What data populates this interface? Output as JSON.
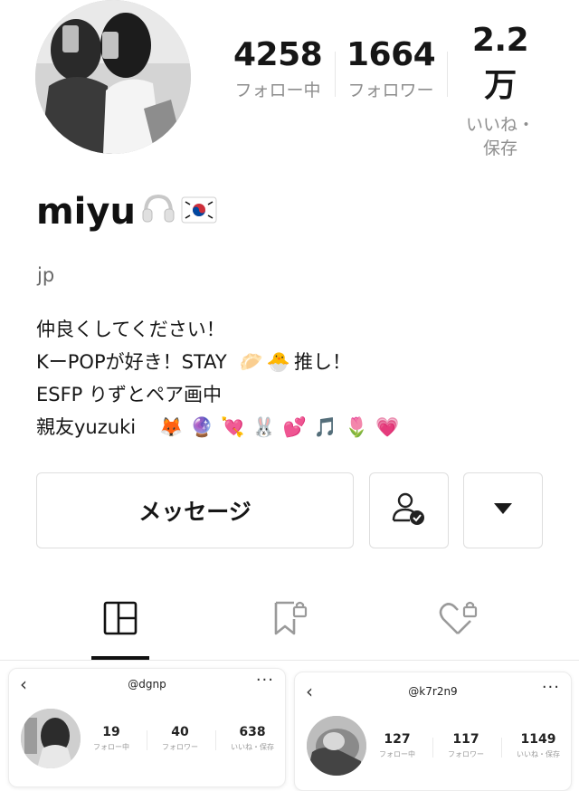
{
  "profile": {
    "username": "miyu",
    "subname": "jp",
    "stats": [
      {
        "value": "4258",
        "label": "フォロー中"
      },
      {
        "value": "1664",
        "label": "フォロワー"
      },
      {
        "value": "2.2万",
        "label": "いいね・保存"
      }
    ],
    "name_emojis": [
      "headphones-icon",
      "korea-flag-icon"
    ],
    "bio": [
      {
        "text": "仲良くしてください！"
      },
      {
        "text": "KーPOPが好き！STAY",
        "after": "🥟🐣",
        "tail": "推し！"
      },
      {
        "text": "ESFP りずとペア画中"
      },
      {
        "text": "親友yuzuki",
        "after": "🦊🔮💘🐰💕🎵🌷💗"
      }
    ]
  },
  "actions": {
    "message_label": "メッセージ",
    "follow_icon": "user-check-icon",
    "more_icon": "dropdown-triangle-icon"
  },
  "tabs": [
    {
      "icon": "grid-icon",
      "active": true
    },
    {
      "icon": "bookmark-lock-icon",
      "active": false
    },
    {
      "icon": "heart-lock-icon",
      "active": false
    }
  ],
  "posts": [
    {
      "handle": "@dgnp",
      "back": "‹",
      "menu": "···",
      "stats": [
        {
          "value": "19",
          "label": "フォロー中"
        },
        {
          "value": "40",
          "label": "フォロワー"
        },
        {
          "value": "638",
          "label": "いいね・保存"
        }
      ]
    },
    {
      "handle": "@k7r2n9",
      "back": "‹",
      "menu": "···",
      "stats": [
        {
          "value": "127",
          "label": "フォロー中"
        },
        {
          "value": "117",
          "label": "フォロワー"
        },
        {
          "value": "1149",
          "label": "いいね・保存"
        }
      ]
    }
  ]
}
